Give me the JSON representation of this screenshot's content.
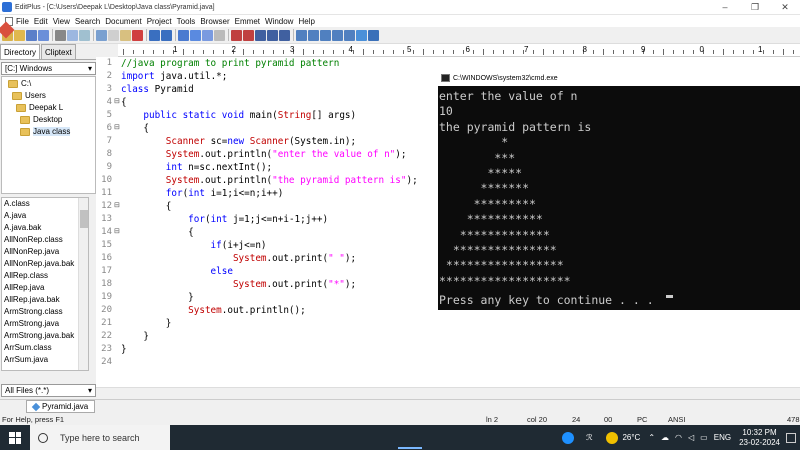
{
  "window": {
    "title": "EditPlus - [C:\\Users\\Deepak L\\Desktop\\Java class\\Pyramid.java]",
    "controls": [
      "–",
      "❐",
      "✕"
    ]
  },
  "menu": [
    "File",
    "Edit",
    "View",
    "Search",
    "Document",
    "Project",
    "Tools",
    "Browser",
    "Emmet",
    "Window",
    "Help"
  ],
  "sidebar": {
    "tabs": [
      "Directory",
      "Cliptext"
    ],
    "drive": "[C:] Windows",
    "tree": [
      "C:\\",
      "Users",
      "Deepak L",
      "Desktop",
      "Java class"
    ],
    "files": [
      "A.class",
      "A.java",
      "A.java.bak",
      "AllNonRep.class",
      "AllNonRep.java",
      "AllNonRep.java.bak",
      "AllRep.class",
      "AllRep.java",
      "AllRep.java.bak",
      "ArmStrong.class",
      "ArmStrong.java",
      "ArmStrong.java.bak",
      "ArrSum.class",
      "ArrSum.java"
    ],
    "filter": "All Files (*.*)"
  },
  "ruler": [
    "1",
    "2",
    "3",
    "4",
    "5",
    "6",
    "7",
    "8",
    "9",
    "0",
    "1"
  ],
  "code": {
    "line_numbers": [
      "1",
      "2",
      "3",
      "4",
      "5",
      "6",
      "7",
      "8",
      "9",
      "10",
      "11",
      "12",
      "13",
      "14",
      "15",
      "16",
      "17",
      "18",
      "19",
      "20",
      "21",
      "22",
      "23",
      "24"
    ],
    "l1": "//java program to print pyramid pattern",
    "l2a": "import",
    "l2b": " java.util.*;",
    "l3a": "class",
    "l3b": " Pyramid",
    "l4": "{",
    "l5a": "    public static void",
    "l5b": " main(",
    "l5c": "String",
    "l5d": "[] args)",
    "l6": "    {",
    "l7a": "        Scanner",
    "l7b": " sc=",
    "l7c": "new",
    "l7d": " Scanner",
    "l7e": "(System.in);",
    "l8a": "        System",
    "l8b": ".out.println(",
    "l8c": "\"enter the value of n\"",
    "l8d": ");",
    "l9a": "        int",
    "l9b": " n=sc.nextInt();",
    "l10a": "        System",
    "l10b": ".out.println(",
    "l10c": "\"the pyramid pattern is\"",
    "l10d": ");",
    "l11a": "        for",
    "l11b": "(",
    "l11c": "int",
    "l11d": " i=1;i<=n;i++)",
    "l12": "        {",
    "l13a": "            for",
    "l13b": "(",
    "l13c": "int",
    "l13d": " j=1;j<=n+i-1;j++)",
    "l14": "            {",
    "l15a": "                if",
    "l15b": "(i+j<=n)",
    "l16a": "                    System",
    "l16b": ".out.print(",
    "l16c": "\" \"",
    "l16d": ");",
    "l17a": "                else",
    "l18a": "                    System",
    "l18b": ".out.print(",
    "l18c": "\"*\"",
    "l18d": ");",
    "l19": "            }",
    "l20a": "            System",
    "l20b": ".out.println();",
    "l21": "        }",
    "l22": "    }",
    "l23": "}",
    "l24": ""
  },
  "cmd": {
    "title": "C:\\WINDOWS\\system32\\cmd.exe",
    "lines": [
      "enter the value of n",
      "10",
      "the pyramid pattern is",
      "         *",
      "        ***",
      "       *****",
      "      *******",
      "     *********",
      "    ***********",
      "   *************",
      "  ***************",
      " *****************",
      "*******************",
      "Press any key to continue . . . "
    ]
  },
  "doc_tab": "Pyramid.java",
  "status": {
    "help": "For Help, press F1",
    "ln": "ln 2",
    "col": "col 20",
    "n1": "24",
    "n2": "00",
    "pc": "PC",
    "enc": "ANSI",
    "extra": "478"
  },
  "taskbar": {
    "search_placeholder": "Type here to search",
    "temp": "26°C",
    "lang": "ENG",
    "time": "10:32 PM",
    "date": "23-02-2024"
  }
}
